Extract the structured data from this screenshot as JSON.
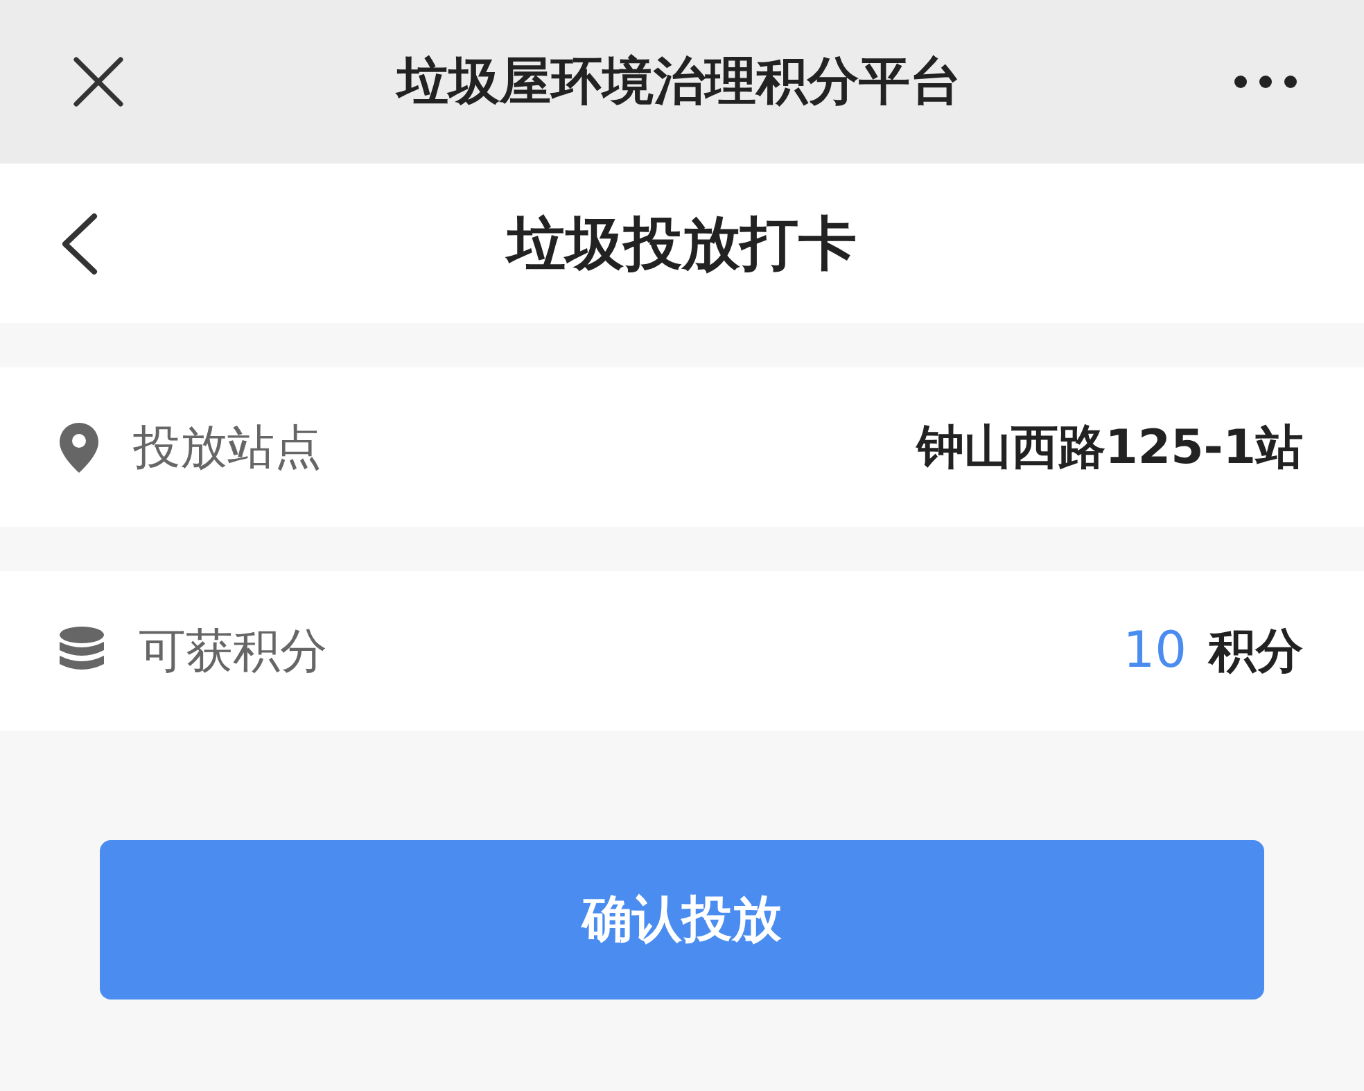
{
  "top_bar": {
    "title": "垃圾屋环境治理积分平台"
  },
  "nav_bar": {
    "title": "垃圾投放打卡"
  },
  "rows": [
    {
      "kind": "location",
      "label": "投放站点",
      "value": "钟山西路125-1站"
    },
    {
      "kind": "points",
      "label": "可获积分",
      "points": "10",
      "unit": "积分"
    }
  ],
  "button": {
    "label": "确认投放"
  }
}
